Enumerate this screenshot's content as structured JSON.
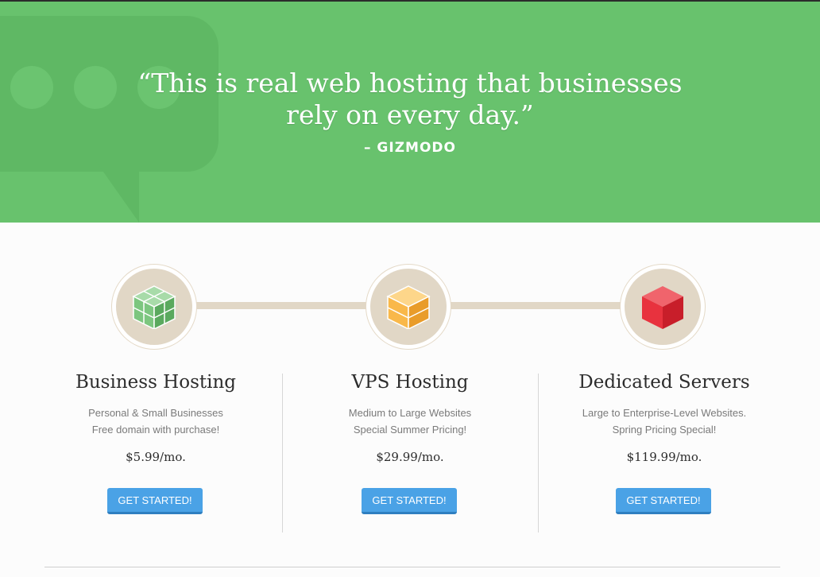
{
  "hero": {
    "quote_line1": "“This is real web hosting that businesses",
    "quote_line2": "rely on every day.”",
    "attribution": "– GIZMODO",
    "background_color": "#68c26d",
    "decor_icon": "speech-bubble-icon"
  },
  "plans": [
    {
      "icon": "green-cube-cluster-icon",
      "color": "#7cc67f",
      "title": "Business Hosting",
      "desc_line1": "Personal & Small Businesses",
      "desc_line2": "Free domain with purchase!",
      "price": "$5.99/mo.",
      "cta": "GET STARTED!"
    },
    {
      "icon": "orange-cube-stack-icon",
      "color": "#f9b84a",
      "title": "VPS Hosting",
      "desc_line1": "Medium to Large Websites",
      "desc_line2": "Special Summer Pricing!",
      "price": "$29.99/mo.",
      "cta": "GET STARTED!"
    },
    {
      "icon": "red-cube-icon",
      "color": "#e8323e",
      "title": "Dedicated Servers",
      "desc_line1": "Large to Enterprise-Level Websites.",
      "desc_line2": "Spring Pricing Special!",
      "price": "$119.99/mo.",
      "cta": "GET STARTED!"
    }
  ],
  "colors": {
    "button": "#4aa2e6",
    "connector": "#e1d7c6"
  }
}
